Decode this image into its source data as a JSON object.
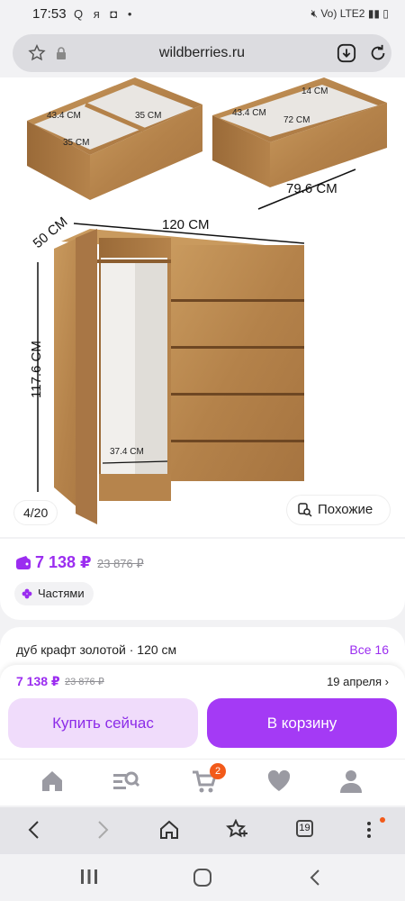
{
  "status_bar": {
    "time": "17:53",
    "left_icons": "Q я ◘ •",
    "right_text": "Vo) LTE2"
  },
  "browser": {
    "url": "wildberries.ru",
    "tabs_count": "19"
  },
  "gallery": {
    "counter": "4/20",
    "similar_label": "Похожие",
    "dims": {
      "top_left_a": "35 CM",
      "top_left_b": "35 CM",
      "top_left_depth": "43.4 CM",
      "top_right_inner": "72 CM",
      "top_right_small": "14 CM",
      "top_right_depth": "43.4 CM",
      "top_right_width": "79.6 CM",
      "width": "120 CM",
      "depth": "50 CM",
      "height": "117.6 CM",
      "inner": "37.4 CM"
    }
  },
  "price": {
    "current": "7 138 ₽",
    "old": "23 876 ₽",
    "installments": "Частями"
  },
  "variant": {
    "name": "дуб крафт золотой · 120 см",
    "all_label": "Все 16"
  },
  "buy_bar": {
    "price": "7 138 ₽",
    "old": "23 876 ₽",
    "delivery": "19 апреля ›",
    "buy_now": "Купить сейчас",
    "add_to_cart": "В корзину"
  },
  "tab_bar": {
    "cart_badge": "2"
  },
  "colors": {
    "accent": "#a43af5",
    "accent_light": "#f0dcfb",
    "price": "#9b2df0",
    "badge": "#f25a1a",
    "wood": "#b8864e"
  }
}
